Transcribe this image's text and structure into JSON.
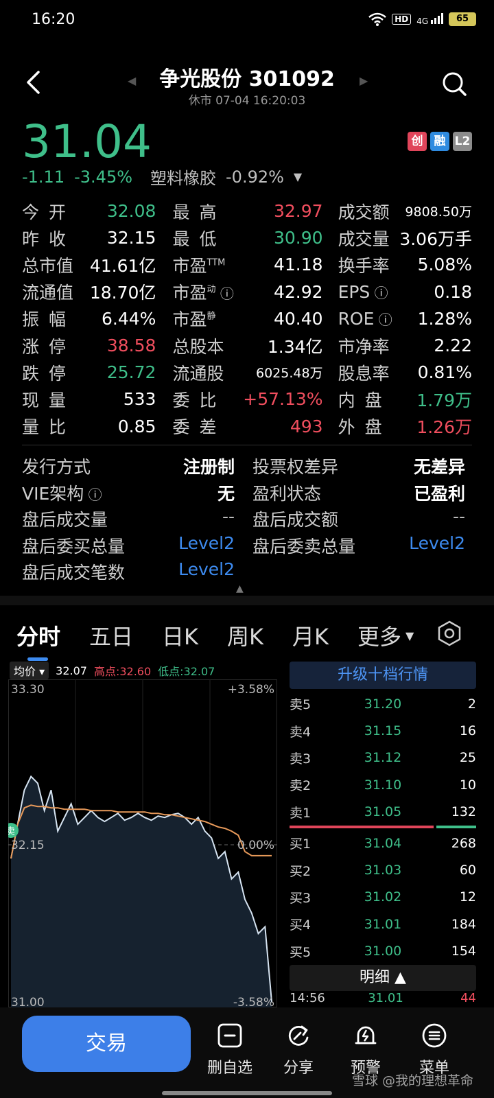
{
  "status": {
    "time": "16:20",
    "hd": "HD",
    "signal": "4G",
    "battery": "65"
  },
  "header": {
    "title": "争光股份 301092",
    "subtitle": "休市  07-04 16:20:03"
  },
  "price": {
    "last": "31.04",
    "change": "-1.11",
    "change_pct": "-3.45%",
    "sector": "塑料橡胶",
    "sector_pct": "-0.92%"
  },
  "tags": [
    "创",
    "融",
    "L2"
  ],
  "stats": [
    [
      {
        "l": "今开",
        "v": "32.08",
        "c": "green",
        "spread": true
      },
      {
        "l": "最高",
        "v": "32.97",
        "c": "red",
        "spread": true
      },
      {
        "l": "成交额",
        "v": "9808.50万",
        "small": true
      }
    ],
    [
      {
        "l": "昨收",
        "v": "32.15",
        "spread": true
      },
      {
        "l": "最低",
        "v": "30.90",
        "c": "green",
        "spread": true
      },
      {
        "l": "成交量",
        "v": "3.06万手"
      }
    ],
    [
      {
        "l": "总市值",
        "v": "41.61亿"
      },
      {
        "l": "市盈",
        "sup": "TTM",
        "v": "41.18"
      },
      {
        "l": "换手率",
        "v": "5.08%"
      }
    ],
    [
      {
        "l": "流通值",
        "v": "18.70亿"
      },
      {
        "l": "市盈",
        "sup": "动",
        "info": true,
        "v": "42.92"
      },
      {
        "l": "EPS",
        "info": true,
        "v": "0.18"
      }
    ],
    [
      {
        "l": "振幅",
        "v": "6.44%",
        "spread": true
      },
      {
        "l": "市盈",
        "sup": "静",
        "v": "40.40"
      },
      {
        "l": "ROE",
        "info": true,
        "v": "1.28%"
      }
    ],
    [
      {
        "l": "涨停",
        "v": "38.58",
        "c": "red",
        "spread": true
      },
      {
        "l": "总股本",
        "v": "1.34亿"
      },
      {
        "l": "市净率",
        "v": "2.22"
      }
    ],
    [
      {
        "l": "跌停",
        "v": "25.72",
        "c": "green",
        "spread": true
      },
      {
        "l": "流通股",
        "v": "6025.48万",
        "small": true
      },
      {
        "l": "股息率",
        "v": "0.81%"
      }
    ],
    [
      {
        "l": "现量",
        "v": "533",
        "spread": true
      },
      {
        "l": "委比",
        "v": "+57.13%",
        "c": "red",
        "spread": true
      },
      {
        "l": "内盘",
        "v": "1.79万",
        "c": "green",
        "spread": true
      }
    ],
    [
      {
        "l": "量比",
        "v": "0.85",
        "spread": true
      },
      {
        "l": "委差",
        "v": "493",
        "c": "red",
        "spread": true
      },
      {
        "l": "外盘",
        "v": "1.26万",
        "c": "red",
        "spread": true
      }
    ]
  ],
  "info": [
    [
      {
        "k": "发行方式",
        "v": "注册制"
      },
      {
        "k": "投票权差异",
        "v": "无差异"
      }
    ],
    [
      {
        "k": "VIE架构",
        "info": true,
        "v": "无"
      },
      {
        "k": "盈利状态",
        "v": "已盈利"
      }
    ],
    [
      {
        "k": "盘后成交量",
        "v": "--",
        "t": "dash"
      },
      {
        "k": "盘后成交额",
        "v": "--",
        "t": "dash"
      }
    ],
    [
      {
        "k": "盘后委买总量",
        "v": "Level2",
        "t": "blue"
      },
      {
        "k": "盘后委卖总量",
        "v": "Level2",
        "t": "blue"
      }
    ],
    [
      {
        "k": "盘后成交笔数",
        "v": "Level2",
        "t": "blue"
      }
    ]
  ],
  "tabs": [
    "分时",
    "五日",
    "日K",
    "周K",
    "月K"
  ],
  "tab_more": "更多",
  "chart_head": {
    "avg_label": "均价",
    "avg_value": "32.07",
    "high": "高点:32.60",
    "low": "低点:32.07"
  },
  "chart_data": {
    "type": "line",
    "y_top": "33.30",
    "y_mid": "32.15",
    "y_bottom": "31.00",
    "pct_top": "+3.58%",
    "pct_mid": "0.00%",
    "pct_bottom": "-3.58%",
    "ylim": [
      31.0,
      33.3
    ],
    "prev_close": 32.15,
    "sell_marker": "卖",
    "series": [
      {
        "values": [
          32.05,
          32.3,
          32.55,
          32.65,
          32.6,
          32.4,
          32.55,
          32.25,
          32.35,
          32.45,
          32.3,
          32.35,
          32.4,
          32.35,
          32.32,
          32.35,
          32.38,
          32.33,
          32.35,
          32.38,
          32.35,
          32.33,
          32.36,
          32.35,
          32.37,
          32.38,
          32.35,
          32.3,
          32.35,
          32.25,
          32.2,
          32.05,
          32.1,
          31.9,
          31.95,
          31.75,
          31.65,
          31.5,
          31.55,
          31.0
        ]
      },
      {
        "values": [
          32.05,
          32.3,
          32.42,
          32.44,
          32.43,
          32.43,
          32.42,
          32.42,
          32.41,
          32.41,
          32.41,
          32.41,
          32.4,
          32.4,
          32.4,
          32.4,
          32.39,
          32.39,
          32.39,
          32.39,
          32.39,
          32.38,
          32.38,
          32.37,
          32.37,
          32.36,
          32.35,
          32.34,
          32.33,
          32.32,
          32.3,
          32.28,
          32.27,
          32.25,
          32.22,
          32.1,
          32.07,
          32.07,
          32.07,
          32.07
        ]
      }
    ]
  },
  "orderbook": {
    "upgrade": "升级十档行情",
    "rows": [
      {
        "l": "卖5",
        "p": "31.20",
        "q": "2"
      },
      {
        "l": "卖4",
        "p": "31.15",
        "q": "16"
      },
      {
        "l": "卖3",
        "p": "31.12",
        "q": "25"
      },
      {
        "l": "卖2",
        "p": "31.10",
        "q": "10"
      },
      {
        "l": "卖1",
        "p": "31.05",
        "q": "132"
      },
      {
        "l": "买1",
        "p": "31.04",
        "q": "268"
      },
      {
        "l": "买2",
        "p": "31.03",
        "q": "60"
      },
      {
        "l": "买3",
        "p": "31.02",
        "q": "12"
      },
      {
        "l": "买4",
        "p": "31.01",
        "q": "184"
      },
      {
        "l": "买5",
        "p": "31.00",
        "q": "154"
      }
    ],
    "detail": "明细",
    "last_trade": {
      "t": "14:56",
      "p": "31.01",
      "q": "44"
    }
  },
  "bottom": {
    "trade": "交易",
    "remove": "删自选",
    "share": "分享",
    "alert": "预警",
    "menu": "菜单",
    "watermark": "雪球 @我的理想革命"
  }
}
